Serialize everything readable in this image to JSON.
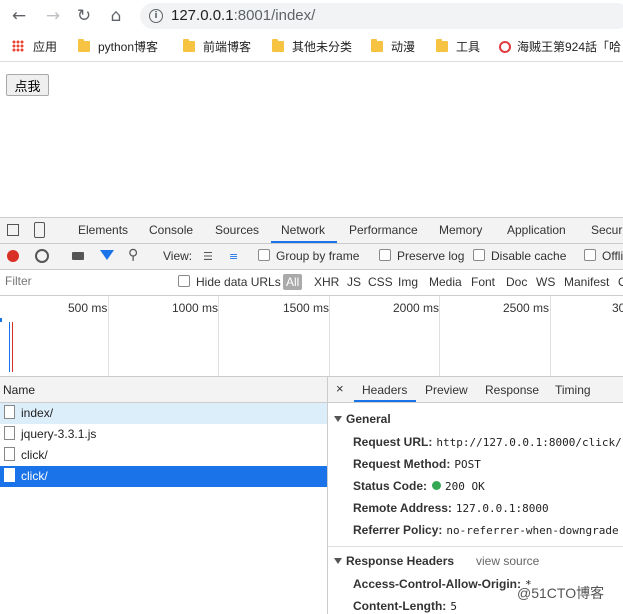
{
  "browser": {
    "url_host": "127.0.0.1",
    "url_rest": ":8001/index/"
  },
  "bookmarks": [
    {
      "label": "应用"
    },
    {
      "label": "python博客"
    },
    {
      "label": "前端博客"
    },
    {
      "label": "其他未分类"
    },
    {
      "label": "动漫"
    },
    {
      "label": "工具"
    },
    {
      "label": "海贼王第924話「哈"
    }
  ],
  "page": {
    "button_label": "点我"
  },
  "devtools": {
    "tabs": [
      "Elements",
      "Console",
      "Sources",
      "Network",
      "Performance",
      "Memory",
      "Application",
      "Securi"
    ],
    "toolbar": {
      "view_label": "View:",
      "group_by_frame": "Group by frame",
      "preserve_log": "Preserve log",
      "disable_cache": "Disable cache",
      "offline": "Offli"
    },
    "filter": {
      "placeholder": "Filter",
      "hide_data_urls": "Hide data URLs",
      "types": [
        "All",
        "XHR",
        "JS",
        "CSS",
        "Img",
        "Media",
        "Font",
        "Doc",
        "WS",
        "Manifest",
        "O"
      ]
    },
    "timeline_labels": [
      "500 ms",
      "1000 ms",
      "1500 ms",
      "2000 ms",
      "2500 ms",
      "30"
    ],
    "list": {
      "header": "Name",
      "rows": [
        "index/",
        "jquery-3.3.1.js",
        "click/",
        "click/"
      ]
    },
    "detail": {
      "close": "×",
      "tabs": [
        "Headers",
        "Preview",
        "Response",
        "Timing"
      ],
      "general_title": "General",
      "general": [
        {
          "k": "Request URL:",
          "v": "http://127.0.0.1:8000/click/"
        },
        {
          "k": "Request Method:",
          "v": "POST"
        },
        {
          "k": "Status Code:",
          "v": "200 OK"
        },
        {
          "k": "Remote Address:",
          "v": "127.0.0.1:8000"
        },
        {
          "k": "Referrer Policy:",
          "v": "no-referrer-when-downgrade"
        }
      ],
      "response_title": "Response Headers",
      "view_source": "view source",
      "response": [
        {
          "k": "Access-Control-Allow-Origin:",
          "v": "*"
        },
        {
          "k": "Content-Length:",
          "v": "5"
        }
      ]
    }
  },
  "watermark": "@51CTO博客",
  "colors": {
    "accent": "#1a73e8",
    "selected_row": "#1a73e8",
    "status_ok": "#34a853",
    "record": "#d93025"
  }
}
